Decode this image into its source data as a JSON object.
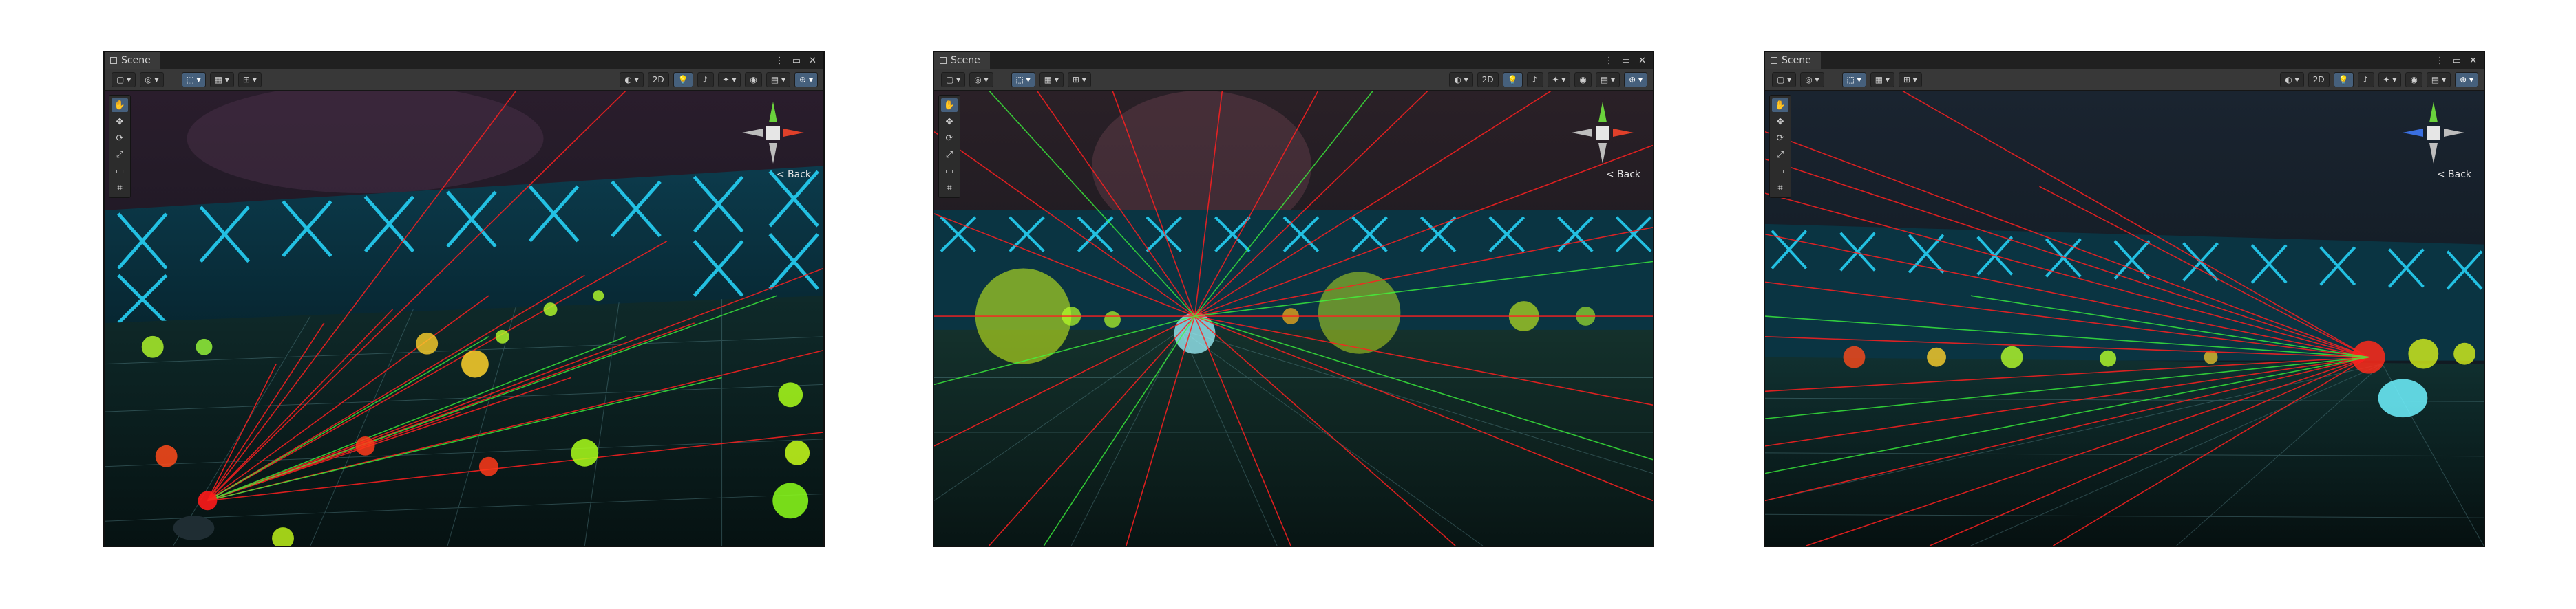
{
  "windows": [
    {
      "tab_label": "Scene",
      "toolbar_2d_label": "2D",
      "gizmo_view_label": "< Back"
    },
    {
      "tab_label": "Scene",
      "toolbar_2d_label": "2D",
      "gizmo_view_label": "< Back"
    },
    {
      "tab_label": "Scene",
      "toolbar_2d_label": "2D",
      "gizmo_view_label": "< Back"
    }
  ],
  "icons": {
    "window": [
      "scene-tab-icon",
      "more-options-icon",
      "maximize-icon",
      "close-icon"
    ],
    "toolbar": [
      "draw-mode-icon",
      "gizmo-icon",
      "transform-tool-icon",
      "grid-icon",
      "snap-icon",
      "shading-icon",
      "lighting-icon",
      "audio-icon",
      "effects-icon",
      "visibility-icon",
      "camera-icon"
    ],
    "tools": [
      "hand-tool-icon",
      "move-tool-icon",
      "rotate-tool-icon",
      "scale-tool-icon",
      "rect-tool-icon",
      "transform-tool-icon"
    ]
  },
  "colors": {
    "editor_background": "#191919",
    "toolbar_background": "#383838",
    "active_tool": "#46607c",
    "neon_wall": "#28d9ff",
    "ray_red": "#ff2020",
    "ray_green": "#3dff3d",
    "gizmo_x": "#e0402a",
    "gizmo_y": "#6ad23c",
    "gizmo_z": "#3a6fe0"
  }
}
